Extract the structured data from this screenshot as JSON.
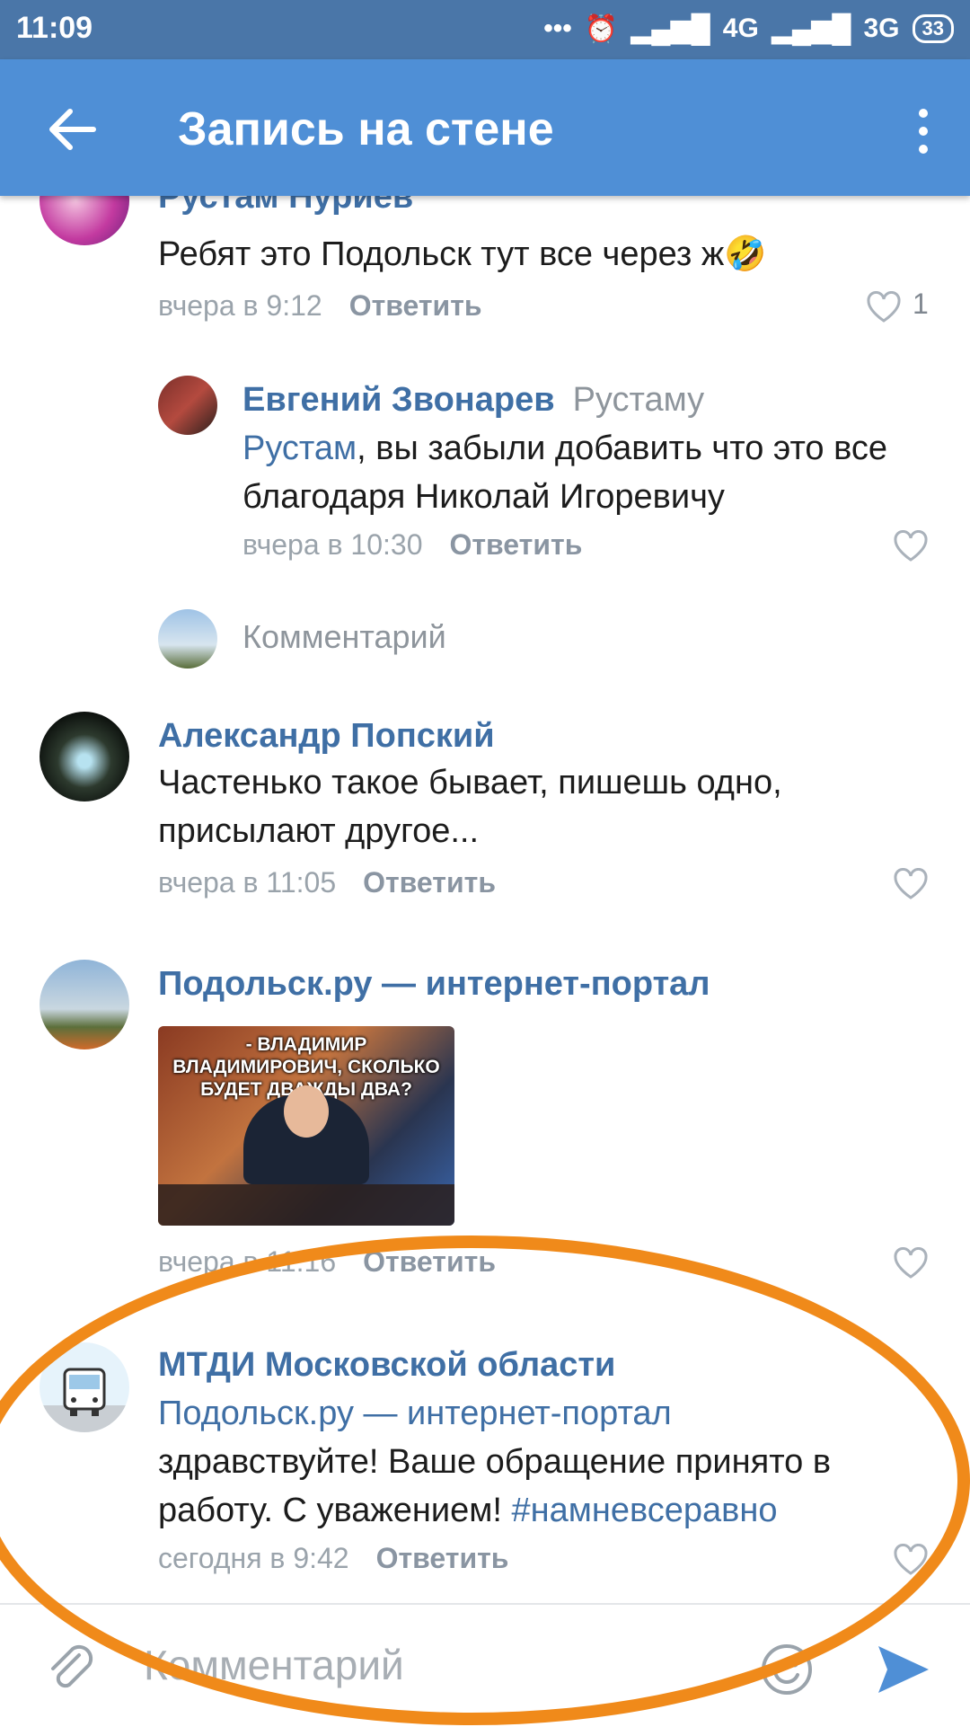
{
  "status_bar": {
    "time": "11:09",
    "network1": "4G",
    "network2": "3G",
    "battery": "33"
  },
  "app_bar": {
    "title": "Запись на стене"
  },
  "comments": [
    {
      "author": "Рустам Нуриев",
      "text": "Ребят это Подольск тут все через ж🤣",
      "time": "вчера в 9:12",
      "reply_label": "Ответить",
      "likes": "1"
    },
    {
      "author": "Евгений Звонарев",
      "reply_to": "Рустаму",
      "mention": "Рустам",
      "text": ", вы забыли добавить что это все благодаря Николай Игоревичу",
      "time": "вчера в 10:30",
      "reply_label": "Ответить"
    },
    {
      "author": "Александр Попский",
      "text": "Частенько такое бывает, пишешь одно, присылают другое...",
      "time": "вчера в 11:05",
      "reply_label": "Ответить"
    },
    {
      "author": "Подольск.ру — интернет-портал",
      "time": "вчера в 11:16",
      "reply_label": "Ответить",
      "image_caption": "- ВЛАДИМИР ВЛАДИМИРОВИЧ, СКОЛЬКО БУДЕТ ДВАЖДЫ ДВА?"
    },
    {
      "author": "МТДИ Московской области",
      "mention": "Подольск.ру — интернет-портал",
      "text": "здравствуйте! Ваше обращение принято в работу. С уважением! ",
      "hashtag": "#намневсеравно",
      "time": "сегодня в 9:42",
      "reply_label": "Ответить"
    }
  ],
  "thread_reply": {
    "placeholder": "Комментарий"
  },
  "composer": {
    "placeholder": "Комментарий"
  },
  "colors": {
    "app_bar": "#4f8fd6",
    "status_bar": "#4a76a8",
    "link": "#3f6fa5",
    "highlight": "#f08a1a"
  }
}
